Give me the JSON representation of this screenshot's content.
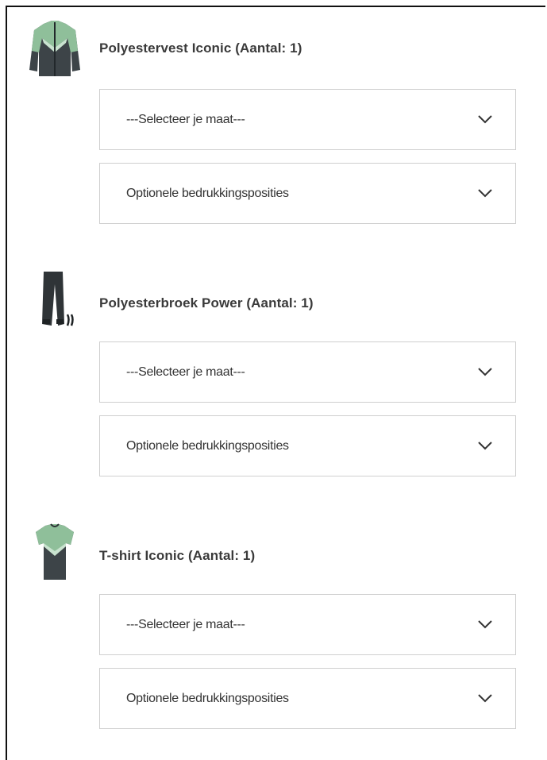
{
  "products": [
    {
      "title": "Polyestervest Iconic (Aantal: 1)",
      "icon": "jacket-icon",
      "size_select": "---Selecteer je maat---",
      "print_select": "Optionele bedrukkingsposities"
    },
    {
      "title": "Polyesterbroek Power (Aantal: 1)",
      "icon": "pants-icon",
      "size_select": "---Selecteer je maat---",
      "print_select": "Optionele bedrukkingsposities"
    },
    {
      "title": "T-shirt Iconic (Aantal: 1)",
      "icon": "tshirt-icon",
      "size_select": "---Selecteer je maat---",
      "print_select": "Optionele bedrukkingsposities"
    }
  ],
  "colors": {
    "jersey_green": "#8fbf9a",
    "jersey_dark": "#3d4448",
    "border": "#cfcfcf"
  }
}
